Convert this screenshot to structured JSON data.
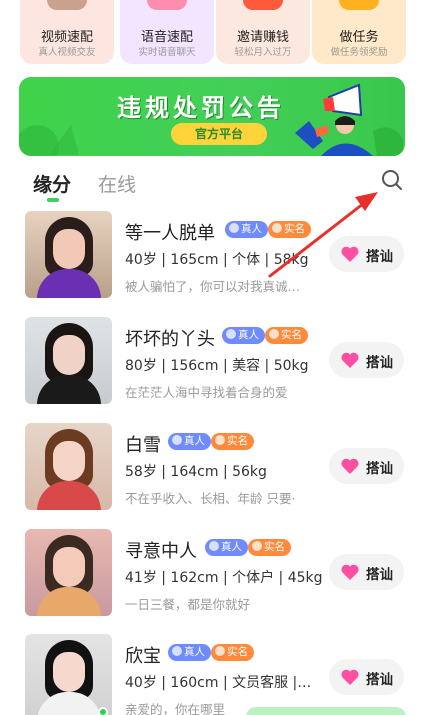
{
  "features": [
    {
      "title": "视频速配",
      "subtitle": "真人视频交友",
      "icon": "video-icon"
    },
    {
      "title": "语音速配",
      "subtitle": "实时语音聊天",
      "icon": "voice-icon"
    },
    {
      "title": "邀请赚钱",
      "subtitle": "轻松月入过万",
      "icon": "money-icon"
    },
    {
      "title": "做任务",
      "subtitle": "做任务领奖励",
      "icon": "task-icon"
    }
  ],
  "banner": {
    "title": "违规处罚公告",
    "badge": "官方平台"
  },
  "tabs": [
    {
      "label": "缘分",
      "active": true
    },
    {
      "label": "在线",
      "active": false
    }
  ],
  "badges": {
    "real": "真人",
    "realname": "实名"
  },
  "greet_label": "搭讪",
  "users": [
    {
      "name": "等一人脱单",
      "info": "40岁 | 165cm | 个体 | 58kg",
      "bio": "被人骗怕了，你可以对我真诚…"
    },
    {
      "name": "坏坏的丫头",
      "info": "80岁 | 156cm | 美容 | 50kg",
      "bio": "在茫茫人海中寻找着合身的爱"
    },
    {
      "name": "白雪",
      "info": "58岁 | 164cm | 56kg",
      "bio": "不在乎收入、长相、年龄 只要·"
    },
    {
      "name": "寻意中人",
      "info": "41岁 | 162cm | 个体户 | 45kg",
      "bio": "一日三餐，都是你就好"
    },
    {
      "name": "欣宝",
      "info": "40岁 | 160cm | 文员客服 |…",
      "bio": "亲爱的，你在哪里"
    }
  ],
  "colors": {
    "accent_green": "#3fcf5b",
    "badge_real": "#6f8bff",
    "badge_realname": "#ff8a3c",
    "heart": "#ff4fa3",
    "annotation_arrow": "#e8302a"
  }
}
